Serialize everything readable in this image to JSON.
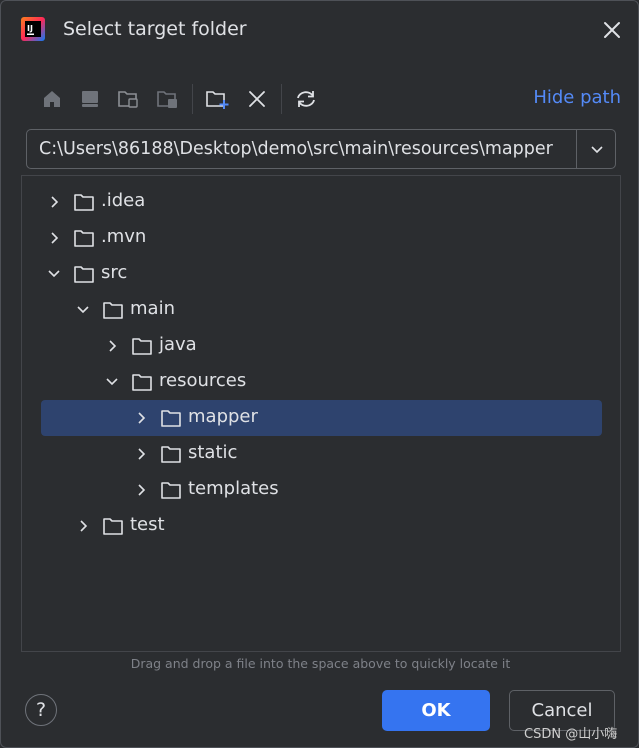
{
  "window": {
    "title": "Select target folder"
  },
  "toolbar": {
    "buttons": [
      "home-icon",
      "desktop-icon",
      "project-folder-icon",
      "module-folder-icon",
      "new-folder-icon",
      "delete-icon",
      "refresh-icon"
    ],
    "hide_path_label": "Hide path"
  },
  "path": {
    "value": "C:\\Users\\86188\\Desktop\\demo\\src\\main\\resources\\mapper"
  },
  "tree": {
    "items": [
      {
        "label": ".idea",
        "depth": 0,
        "expanded": false,
        "selected": false
      },
      {
        "label": ".mvn",
        "depth": 0,
        "expanded": false,
        "selected": false
      },
      {
        "label": "src",
        "depth": 0,
        "expanded": true,
        "selected": false
      },
      {
        "label": "main",
        "depth": 1,
        "expanded": true,
        "selected": false
      },
      {
        "label": "java",
        "depth": 2,
        "expanded": false,
        "selected": false
      },
      {
        "label": "resources",
        "depth": 2,
        "expanded": true,
        "selected": false
      },
      {
        "label": "mapper",
        "depth": 3,
        "expanded": false,
        "selected": true
      },
      {
        "label": "static",
        "depth": 3,
        "expanded": false,
        "selected": false
      },
      {
        "label": "templates",
        "depth": 3,
        "expanded": false,
        "selected": false
      },
      {
        "label": "test",
        "depth": 1,
        "expanded": false,
        "selected": false
      }
    ]
  },
  "hint": "Drag and drop a file into the space above to quickly locate it",
  "buttons": {
    "help": "?",
    "ok": "OK",
    "cancel": "Cancel"
  },
  "watermark": "CSDN @山小嗨",
  "colors": {
    "background": "#2b2d30",
    "accent": "#3574f0",
    "selection": "#2e436e",
    "link": "#548af7"
  }
}
